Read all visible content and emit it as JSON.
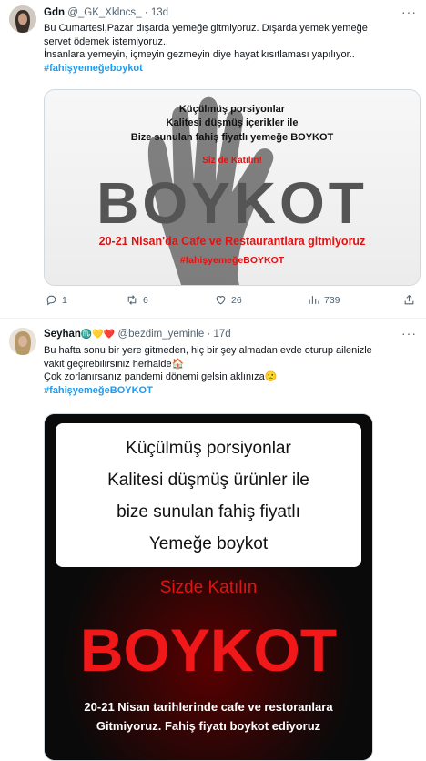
{
  "tweet1": {
    "name": "Gdn",
    "handle": "@_GK_Xklncs_",
    "dot": "·",
    "time": "13d",
    "more": "···",
    "lines": [
      "Bu Cumartesi,Pazar dışarda yemeğe gitmiyoruz. Dışarda yemek yemeğe",
      "servet ödemek istemiyoruz..",
      "İnsanlara yemeyin, içmeyin gezmeyin diye hayat kısıtlaması yapılıyor.."
    ],
    "hashtag": "#fahişyemeğeboykot",
    "image": {
      "line1": "Küçülmüş porsiyonlar",
      "line2": "Kalitesi düşmüş içerikler ile",
      "line3": "Bize sunulan fahiş fiyatlı yemeğe BOYKOT",
      "join": "Siz de Katılın!",
      "big": "BOYKOT",
      "dates": "20-21 Nisan'da Cafe ve Restaurantlara gitmiyoruz",
      "tag": "#fahişyemeğeBOYKOT"
    },
    "actions": {
      "replies": "1",
      "retweets": "6",
      "likes": "26",
      "views": "739"
    }
  },
  "tweet2": {
    "name": "Seyhan",
    "emojis": "♏💛❤️",
    "handle": "@bezdim_yeminle",
    "dot": "·",
    "time": "17d",
    "more": "···",
    "lines": [
      "Bu hafta sonu bir yere gitmeden, hiç bir şey almadan evde oturup ailenizle",
      "vakit geçirebilirsiniz herhalde🏠",
      "Çok zorlanırsanız pandemi dönemi gelsin aklınıza🙁"
    ],
    "hashtag": "#fahişyemeğeBOYKOT",
    "image": {
      "line1": "Küçülmüş porsiyonlar",
      "line2": "Kalitesi düşmüş ürünler ile",
      "line3": "bize sunulan fahiş fiyatlı",
      "line4": "Yemeğe boykot",
      "join": "Sizde Katılın",
      "big": "BOYKOT",
      "bottom1": "20-21 Nisan tarihlerinde cafe ve restoranlara",
      "bottom2": "Gitmiyoruz. Fahiş fiyatı boykot ediyoruz"
    }
  },
  "colors": {
    "accent": "#1d9bf0",
    "text": "#0f1419",
    "muted": "#536471",
    "boycott_red": "#e01212"
  }
}
